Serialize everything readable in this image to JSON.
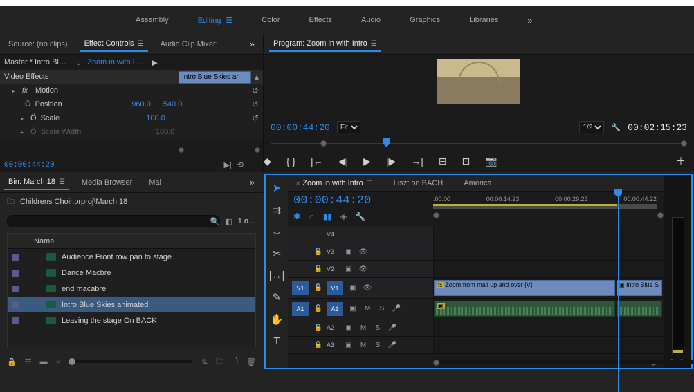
{
  "workspaces": [
    "Assembly",
    "Editing",
    "Color",
    "Effects",
    "Audio",
    "Graphics",
    "Libraries"
  ],
  "workspace_active": 1,
  "source_panel": {
    "tabs": {
      "source": "Source: (no clips)",
      "effect": "Effect Controls",
      "mixer": "Audio Clip Mixer:"
    },
    "master": "Master * Intro Blue …",
    "active": "Zoom in with Int…",
    "clip_overlay": "Intro Blue Skies ar",
    "rows": {
      "video_effects": "Video Effects",
      "motion": "Motion",
      "position": "Position",
      "position_x": "960.0",
      "position_y": "540.0",
      "scale": "Scale",
      "scale_val": "100.0",
      "scale_width": "Scale Width",
      "scale_width_val": "100.0"
    },
    "timecode": "00:00:44:20"
  },
  "project": {
    "bin_tab": "Bin: March 18",
    "browser_tab": "Media Browser",
    "mar_tab": "Mai",
    "path": "Childrens Choir.prproj\\March 18",
    "item_count": "1 o…",
    "name_header": "Name",
    "items": [
      "Audience Front row pan to stage",
      "Dance Macbre",
      "end macabre",
      "Intro Blue Skies animated",
      "Leaving the stage On BACK"
    ],
    "selected_index": 3
  },
  "program": {
    "title": "Program: Zoom in with Intro",
    "timecode_left": "00:00:44:20",
    "timecode_right": "00:02:15:23",
    "fit": "Fit",
    "scale": "1/2"
  },
  "timeline": {
    "tabs": [
      "Zoom in with Intro",
      "Liszt on BACH",
      "America"
    ],
    "active_tab": 0,
    "timecode": "00:00:44:20",
    "ruler_ticks": [
      ":00:00",
      "00:00:14:23",
      "00:00:29:23",
      "00:00:44:22"
    ],
    "video_tracks": [
      "V4",
      "V3",
      "V2",
      "V1"
    ],
    "audio_tracks": [
      "A1",
      "A2",
      "A3"
    ],
    "clip_main": "Zoom from mall up and over [V]",
    "clip_next": "Intro Blue S"
  }
}
